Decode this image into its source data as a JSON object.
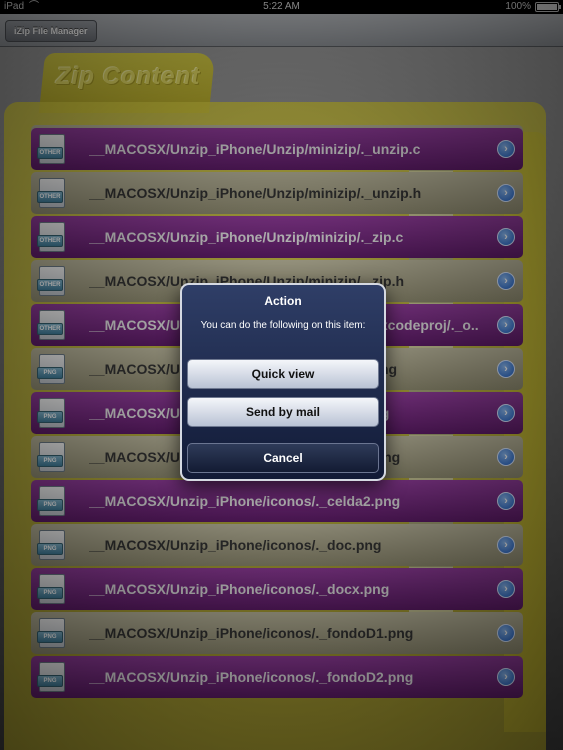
{
  "status_bar": {
    "device": "iPad",
    "time": "5:22 AM",
    "battery": "100%"
  },
  "nav": {
    "button_label": "iZip File Manager"
  },
  "folder": {
    "title": "Zip Content"
  },
  "files": [
    {
      "name": "__MACOSX/Unzip_iPhone/Unzip/minizip/._unzip.c",
      "type": "OTHER",
      "style": "purple"
    },
    {
      "name": "__MACOSX/Unzip_iPhone/Unzip/minizip/._unzip.h",
      "type": "OTHER",
      "style": "olive"
    },
    {
      "name": "__MACOSX/Unzip_iPhone/Unzip/minizip/._zip.c",
      "type": "OTHER",
      "style": "purple"
    },
    {
      "name": "__MACOSX/Unzip_iPhone/Unzip/minizip/._zip.h",
      "type": "OTHER",
      "style": "olive"
    },
    {
      "name": "__MACOSX/Unzip_iPhone/UnzipMgrIphone.xcodeproj/._o...",
      "type": "OTHER",
      "style": "purple"
    },
    {
      "name": "__MACOSX/Unzip_iPhone/iconos/._borrar.png",
      "type": "PNG",
      "style": "olive"
    },
    {
      "name": "__MACOSX/Unzip_iPhone/iconos/._docc.png",
      "type": "PNG",
      "style": "purple"
    },
    {
      "name": "__MACOSX/Unzip_iPhone/iconos/._celda1.png",
      "type": "PNG",
      "style": "olive"
    },
    {
      "name": "__MACOSX/Unzip_iPhone/iconos/._celda2.png",
      "type": "PNG",
      "style": "purple"
    },
    {
      "name": "__MACOSX/Unzip_iPhone/iconos/._doc.png",
      "type": "PNG",
      "style": "olive"
    },
    {
      "name": "__MACOSX/Unzip_iPhone/iconos/._docx.png",
      "type": "PNG",
      "style": "purple"
    },
    {
      "name": "__MACOSX/Unzip_iPhone/iconos/._fondoD1.png",
      "type": "PNG",
      "style": "olive"
    },
    {
      "name": "__MACOSX/Unzip_iPhone/iconos/._fondoD2.png",
      "type": "PNG",
      "style": "purple"
    }
  ],
  "action_sheet": {
    "title": "Action",
    "message": "You can do the following on this item:",
    "quick_view": "Quick view",
    "send_by_mail": "Send by mail",
    "cancel": "Cancel"
  }
}
